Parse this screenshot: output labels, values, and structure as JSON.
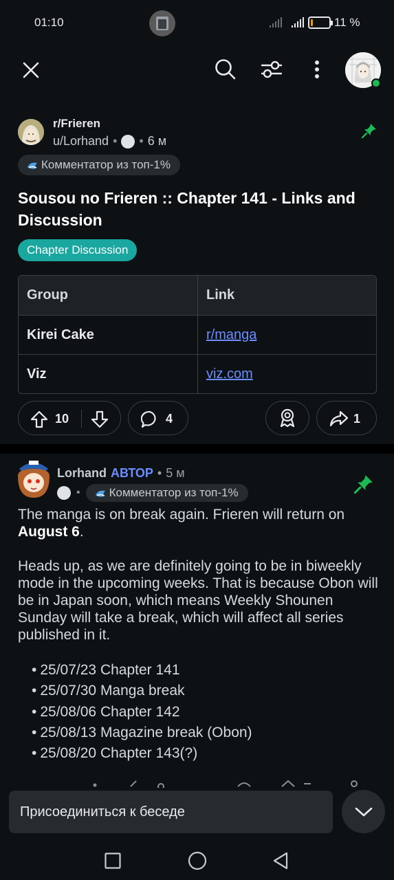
{
  "status_bar": {
    "time": "01:10",
    "battery_percent": "11 %",
    "battery_level": 0.11
  },
  "top_bar": {
    "close_icon": "close-icon",
    "search_icon": "search-icon",
    "filter_icon": "tune-icon",
    "more_icon": "more-vert-icon"
  },
  "post": {
    "subreddit": "r/Frieren",
    "author": "u/Lorhand",
    "age": "6 м",
    "flair": "Комментатор из топ-1%",
    "title": "Sousou no Frieren :: Chapter 141 - Links and Discussion",
    "tag": "Chapter Discussion",
    "table": {
      "headers": [
        "Group",
        "Link"
      ],
      "rows": [
        [
          "Kirei Cake",
          "r/manga"
        ],
        [
          "Viz",
          "viz.com"
        ]
      ]
    },
    "upvotes": "10",
    "comments": "4",
    "shares": "1"
  },
  "comment": {
    "author": "Lorhand",
    "op_label": "АВТОР",
    "age": "5 м",
    "flair": "Комментатор из топ-1%",
    "para1_text": "The manga is on break again. Frieren will return on ",
    "para1_bold": "August 6",
    "para1_end": ".",
    "para2": "Heads up, as we are definitely going to be in biweekly mode in the upcoming weeks. That is because Obon will be in Japan soon, which means Weekly Shounen Sunday will take a break, which will affect all series published in it.",
    "schedule": [
      "25/07/23 Chapter 141",
      "25/07/30 Manga break",
      "25/08/06 Chapter 142",
      "25/08/13 Magazine break (Obon)",
      "25/08/20 Chapter 143(?)"
    ]
  },
  "join": {
    "placeholder": "Присоединиться к беседе"
  },
  "colors": {
    "background": "#0e1113",
    "accent_link": "#6b8dff",
    "tag_teal": "#19a7a0",
    "pin_green": "#1db954"
  }
}
